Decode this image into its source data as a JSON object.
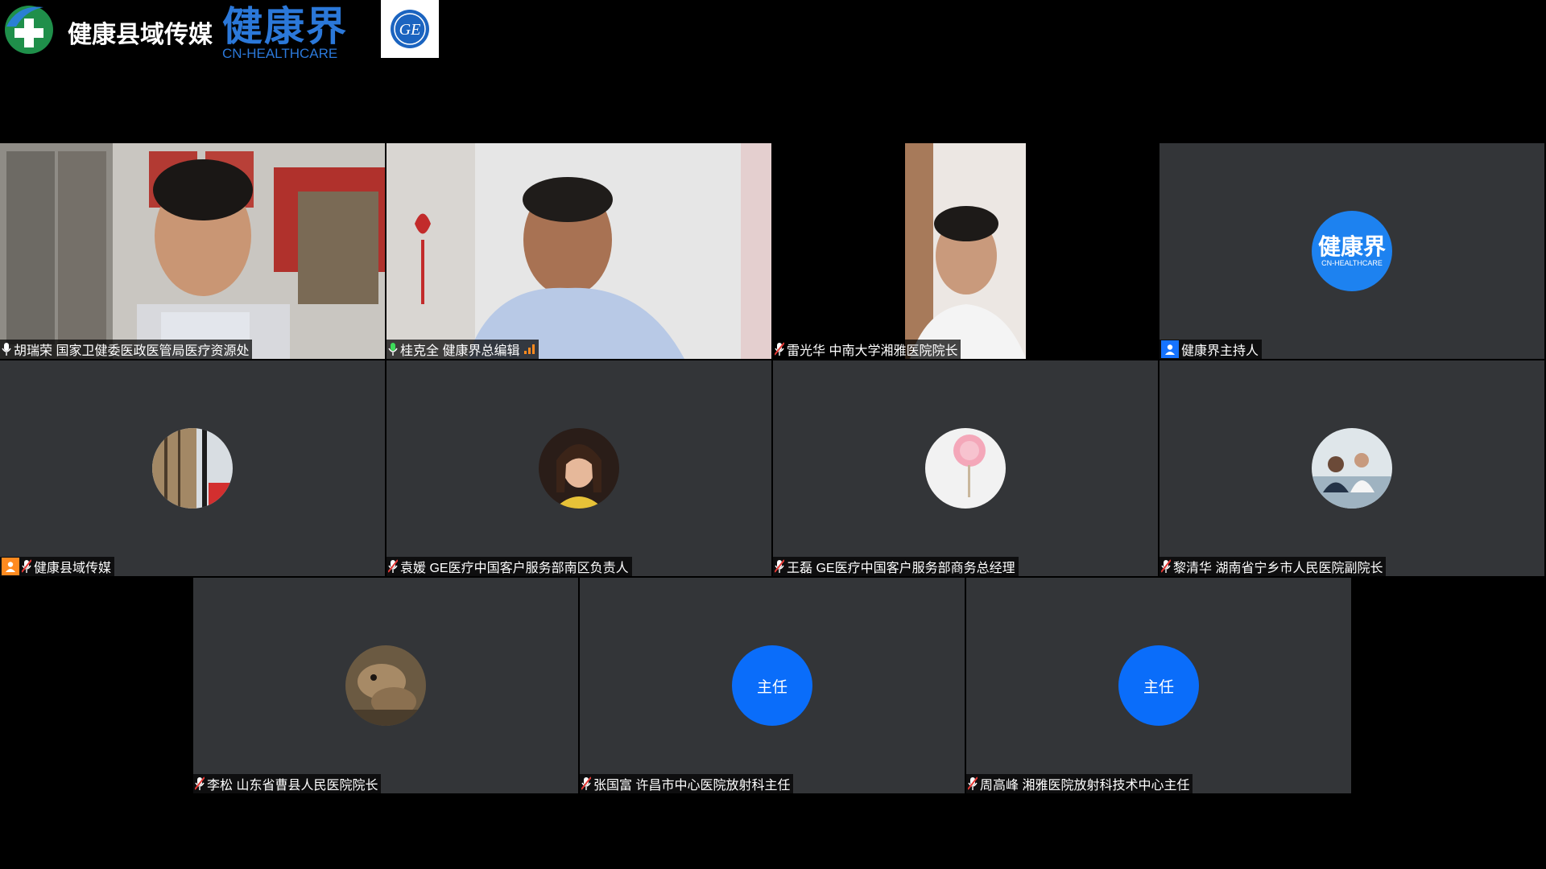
{
  "header": {
    "brand_name": "健康县域传媒",
    "jkj_logo_cn": "健康界",
    "jkj_logo_en": "CN-HEALTHCARE",
    "ge_logo_text": "GE"
  },
  "colors": {
    "tile_bg": "#333538",
    "avatar_blue": "#0a6dfa",
    "host_badge_blue": "#1673ff",
    "cohost_badge_orange": "#ff8a1f",
    "logo_blue": "#2b78d9"
  },
  "participants": [
    {
      "name": "胡瑞荣  国家卫健委医政医管局医疗资源处",
      "video": true,
      "mic": "on"
    },
    {
      "name": "桂克全  健康界总编辑",
      "video": true,
      "mic": "on",
      "speaking": true
    },
    {
      "name": "雷光华  中南大学湘雅医院院长",
      "video": true,
      "mic": "muted"
    },
    {
      "name": "健康界主持人",
      "video": false,
      "role": "host",
      "avatar_text_cn": "健康界",
      "avatar_text_en": "CN-HEALTHCARE"
    },
    {
      "name": "健康县域传媒",
      "video": false,
      "role": "co-host",
      "mic": "muted"
    },
    {
      "name": "袁媛  GE医疗中国客户服务部南区负责人",
      "video": false,
      "mic": "muted"
    },
    {
      "name": "王磊  GE医疗中国客户服务部商务总经理",
      "video": false,
      "mic": "muted"
    },
    {
      "name": "黎清华  湖南省宁乡市人民医院副院长",
      "video": false,
      "mic": "muted"
    },
    {
      "name": "李松  山东省曹县人民医院院长",
      "video": false,
      "mic": "muted"
    },
    {
      "name": "张国富 许昌市中心医院放射科主任",
      "video": false,
      "mic": "muted",
      "avatar_text": "主任"
    },
    {
      "name": "周高峰   湘雅医院放射科技术中心主任",
      "video": false,
      "mic": "muted",
      "avatar_text": "主任"
    }
  ]
}
